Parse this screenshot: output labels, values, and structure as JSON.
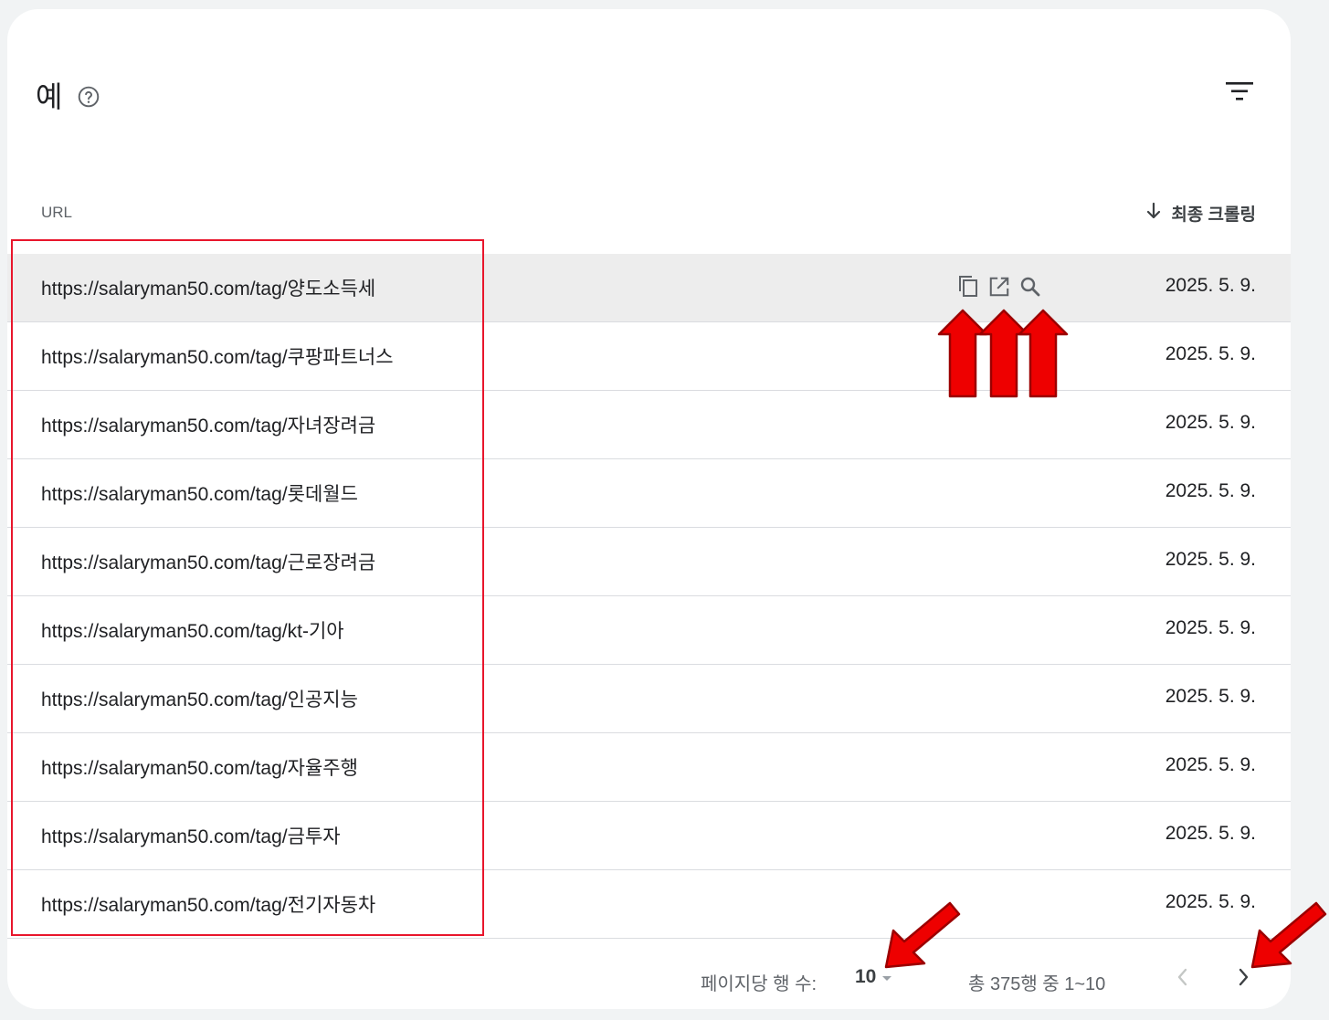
{
  "card": {
    "title": "예",
    "icons": {
      "help": "help-circle-icon",
      "filter": "filter-icon"
    }
  },
  "table": {
    "col_url": "URL",
    "col_crawl": "최종 크롤링",
    "sort": "descending",
    "rows": [
      {
        "url": "https://salaryman50.com/tag/양도소득세",
        "date": "2025. 5. 9."
      },
      {
        "url": "https://salaryman50.com/tag/쿠팡파트너스",
        "date": "2025. 5. 9."
      },
      {
        "url": "https://salaryman50.com/tag/자녀장려금",
        "date": "2025. 5. 9."
      },
      {
        "url": "https://salaryman50.com/tag/롯데월드",
        "date": "2025. 5. 9."
      },
      {
        "url": "https://salaryman50.com/tag/근로장려금",
        "date": "2025. 5. 9."
      },
      {
        "url": "https://salaryman50.com/tag/kt-기아",
        "date": "2025. 5. 9."
      },
      {
        "url": "https://salaryman50.com/tag/인공지능",
        "date": "2025. 5. 9."
      },
      {
        "url": "https://salaryman50.com/tag/자율주행",
        "date": "2025. 5. 9."
      },
      {
        "url": "https://salaryman50.com/tag/금투자",
        "date": "2025. 5. 9."
      },
      {
        "url": "https://salaryman50.com/tag/전기자동차",
        "date": "2025. 5. 9."
      }
    ],
    "row_actions": [
      "copy-icon",
      "open-in-new-icon",
      "search-icon"
    ]
  },
  "footer": {
    "rows_per_page_label": "페이지당 행 수:",
    "rows_per_page": "10",
    "range": "총 375행 중 1~10"
  },
  "colors": {
    "annotation": "#e8162c",
    "hover_row": "#ededed",
    "divider": "#dadce0"
  }
}
